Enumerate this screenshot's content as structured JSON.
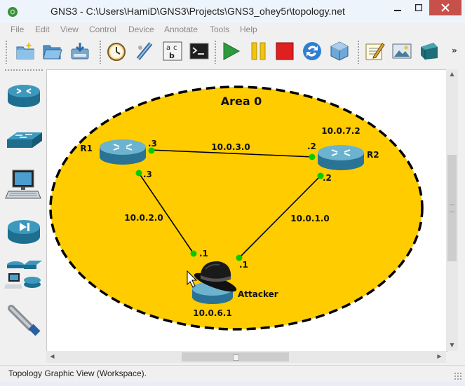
{
  "window": {
    "title": "GNS3 - C:\\Users\\HamiD\\GNS3\\Projects\\GNS3_ohey5r\\topology.net",
    "controls": {
      "minimize": "—",
      "maximize": "☐",
      "close": "✕"
    }
  },
  "menu": {
    "items": [
      {
        "label": "File"
      },
      {
        "label": "Edit"
      },
      {
        "label": "View"
      },
      {
        "label": "Control"
      },
      {
        "label": "Device"
      },
      {
        "label": "Annotate"
      },
      {
        "label": "Tools"
      },
      {
        "label": "Help"
      }
    ]
  },
  "toolbar": {
    "buttons": [
      {
        "icon": "new-project-icon"
      },
      {
        "icon": "open-project-icon"
      },
      {
        "icon": "save-project-icon"
      },
      {
        "icon": "snapshot-clock-icon"
      },
      {
        "icon": "add-link-icon"
      },
      {
        "icon": "show-labels-icon"
      },
      {
        "icon": "console-icon"
      },
      {
        "icon": "start-icon"
      },
      {
        "icon": "suspend-icon"
      },
      {
        "icon": "stop-icon"
      },
      {
        "icon": "reload-icon"
      },
      {
        "icon": "virtualbox-icon"
      },
      {
        "icon": "add-note-icon"
      },
      {
        "icon": "insert-picture-icon"
      },
      {
        "icon": "draw-rectangle-icon"
      }
    ],
    "overflow": "»"
  },
  "device_dock": {
    "items": [
      {
        "icon": "router-icon"
      },
      {
        "icon": "switch-icon"
      },
      {
        "icon": "end-device-icon"
      },
      {
        "icon": "security-device-icon"
      },
      {
        "icon": "all-devices-icon"
      },
      {
        "icon": "cable-icon"
      }
    ]
  },
  "topology": {
    "area_label": "Area 0",
    "colors": {
      "area_fill": "#ffcc00",
      "area_border": "#000000",
      "link": "#000000",
      "port_up": "#00cc00",
      "router_body": "#5aa0c0"
    },
    "routers": [
      {
        "name": "R1",
        "id_label": ""
      },
      {
        "name": "R2",
        "id_label": "10.0.7.2"
      },
      {
        "name": "Attacker",
        "id_label": "10.0.6.1"
      }
    ],
    "links": [
      {
        "network": "10.0.3.0",
        "a_port": ".3",
        "b_port": ".2"
      },
      {
        "network": "10.0.2.0",
        "a_port": ".3",
        "b_port": ".1"
      },
      {
        "network": "10.0.1.0",
        "a_port": ".2",
        "b_port": ".1"
      }
    ]
  },
  "scrollbars": {
    "up": "▲",
    "down": "▼",
    "left": "◀",
    "right": "▶"
  },
  "status": {
    "text": "Topology Graphic View (Workspace)."
  }
}
